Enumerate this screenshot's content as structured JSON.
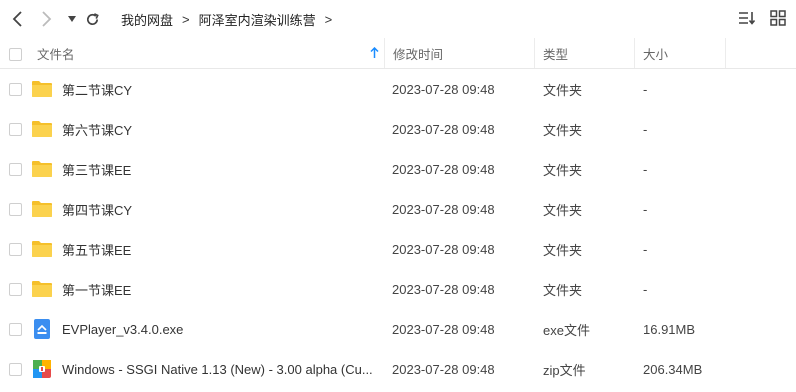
{
  "breadcrumb": {
    "items": [
      "我的网盘",
      "阿泽室内渲染训练营"
    ],
    "separator": ">"
  },
  "toolbar": {
    "sort_icon": "sort-list-icon",
    "view_icon": "grid-view-icon"
  },
  "columns": {
    "name": "文件名",
    "modified": "修改时间",
    "type": "类型",
    "size": "大小"
  },
  "colors": {
    "folder": "#f5c02b",
    "accent": "#1a8cff"
  },
  "files": [
    {
      "name": "第二节课CY",
      "modified": "2023-07-28 09:48",
      "type": "文件夹",
      "size": "-",
      "icon": "folder-icon"
    },
    {
      "name": "第六节课CY",
      "modified": "2023-07-28 09:48",
      "type": "文件夹",
      "size": "-",
      "icon": "folder-icon"
    },
    {
      "name": "第三节课EE",
      "modified": "2023-07-28 09:48",
      "type": "文件夹",
      "size": "-",
      "icon": "folder-icon"
    },
    {
      "name": "第四节课CY",
      "modified": "2023-07-28 09:48",
      "type": "文件夹",
      "size": "-",
      "icon": "folder-icon"
    },
    {
      "name": "第五节课EE",
      "modified": "2023-07-28 09:48",
      "type": "文件夹",
      "size": "-",
      "icon": "folder-icon"
    },
    {
      "name": "第一节课EE",
      "modified": "2023-07-28 09:48",
      "type": "文件夹",
      "size": "-",
      "icon": "folder-icon"
    },
    {
      "name": "EVPlayer_v3.4.0.exe",
      "modified": "2023-07-28 09:48",
      "type": "exe文件",
      "size": "16.91MB",
      "icon": "exe-file-icon"
    },
    {
      "name": "Windows - SSGI Native 1.13 (New) - 3.00 alpha (Cu...",
      "modified": "2023-07-28 09:48",
      "type": "zip文件",
      "size": "206.34MB",
      "icon": "zip-file-icon"
    }
  ]
}
